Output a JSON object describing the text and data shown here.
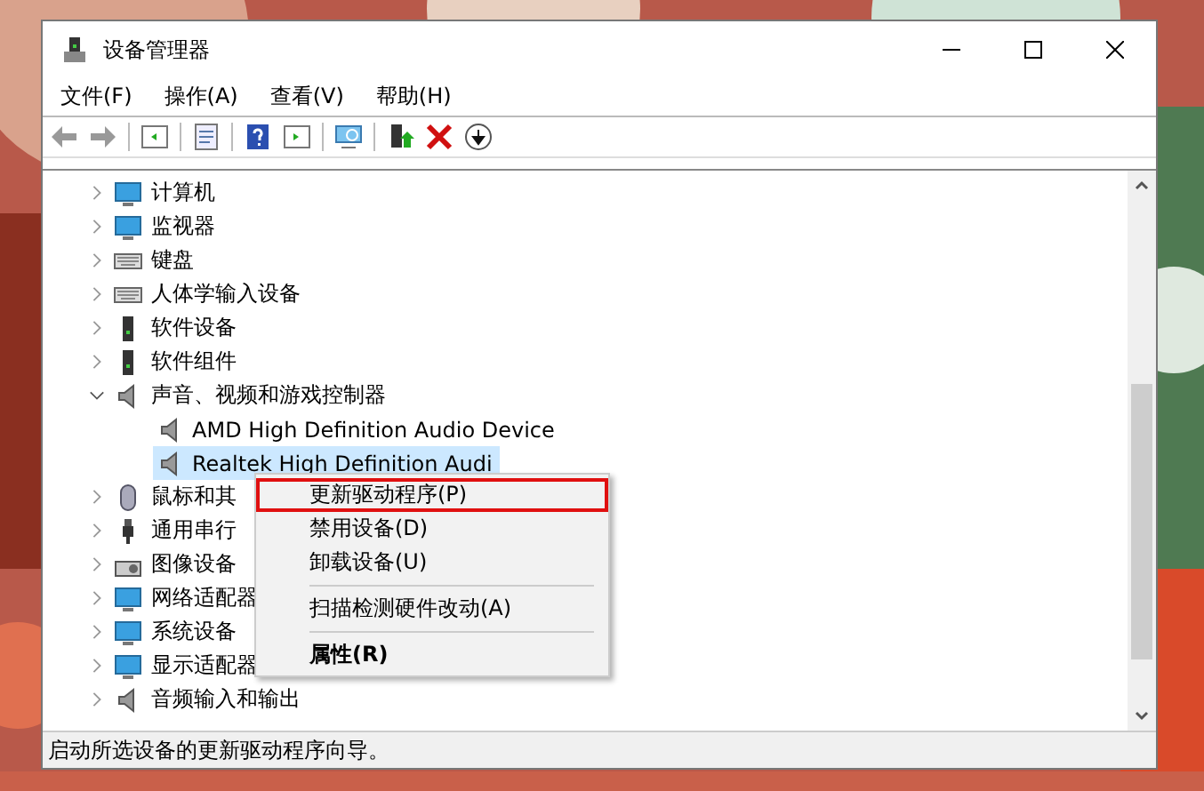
{
  "window": {
    "title": "设备管理器"
  },
  "menu_bar": [
    "文件(F)",
    "操作(A)",
    "查看(V)",
    "帮助(H)"
  ],
  "tree": [
    {
      "label": "计算机",
      "expanded": false
    },
    {
      "label": "监视器",
      "expanded": false
    },
    {
      "label": "键盘",
      "expanded": false
    },
    {
      "label": "人体学输入设备",
      "expanded": false
    },
    {
      "label": "软件设备",
      "expanded": false
    },
    {
      "label": "软件组件",
      "expanded": false
    },
    {
      "label": "声音、视频和游戏控制器",
      "expanded": true,
      "children": [
        {
          "label": "AMD High Definition Audio Device",
          "selected": false
        },
        {
          "label": "Realtek High Definition Audi",
          "selected": true
        }
      ]
    },
    {
      "label": "鼠标和其",
      "expanded": false
    },
    {
      "label": "通用串行",
      "expanded": false
    },
    {
      "label": "图像设备",
      "expanded": false
    },
    {
      "label": "网络适配器",
      "expanded": false
    },
    {
      "label": "系统设备",
      "expanded": false
    },
    {
      "label": "显示适配器",
      "expanded": false
    },
    {
      "label": "音频输入和输出",
      "expanded": false
    }
  ],
  "context_menu": [
    {
      "kind": "item",
      "label": "更新驱动程序(P)",
      "highlighted": true
    },
    {
      "kind": "item",
      "label": "禁用设备(D)",
      "highlighted": false
    },
    {
      "kind": "item",
      "label": "卸载设备(U)",
      "highlighted": false
    },
    {
      "kind": "separator"
    },
    {
      "kind": "item",
      "label": "扫描检测硬件改动(A)",
      "highlighted": false
    },
    {
      "kind": "separator"
    },
    {
      "kind": "bold",
      "label": "属性(R)",
      "highlighted": false
    }
  ],
  "status_bar": "启动所选设备的更新驱动程序向导。"
}
